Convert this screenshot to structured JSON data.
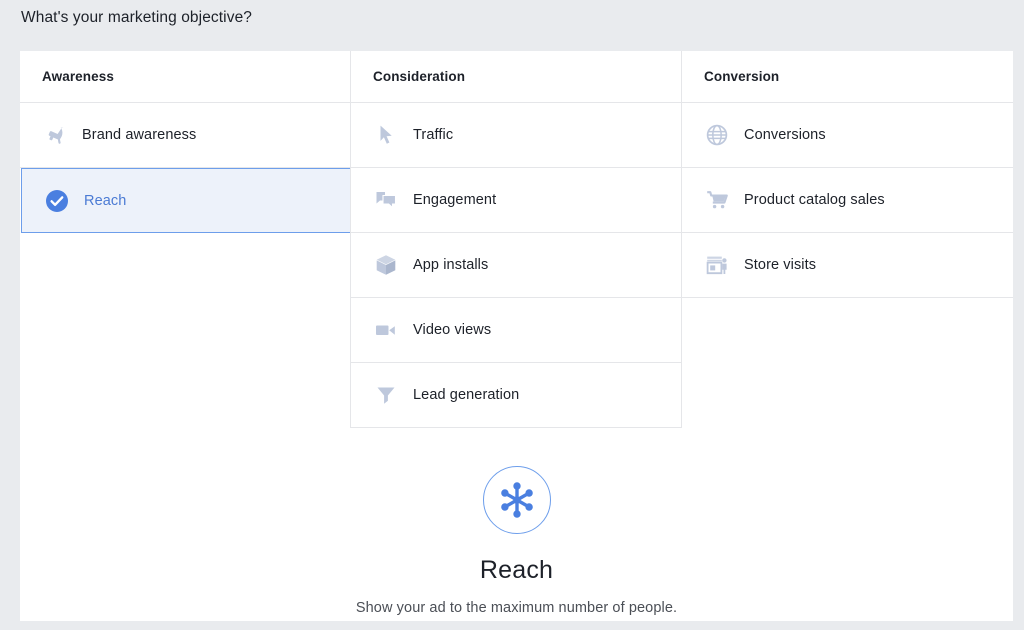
{
  "page": {
    "title": "What's your marketing objective?",
    "background_color": "#e9ebee",
    "card_color": "#ffffff",
    "accent_color": "#4b7bd4",
    "selected_row_bg": "#edf2fa",
    "selected_row_border": "#6d9eeb",
    "icon_color": "#bec8dc",
    "divider_color": "#e5e6e9"
  },
  "columns": [
    {
      "header": "Awareness",
      "items": [
        {
          "label": "Brand awareness",
          "icon": "megaphone-icon",
          "selected": false
        },
        {
          "label": "Reach",
          "icon": "check-circle-icon",
          "selected": true
        }
      ]
    },
    {
      "header": "Consideration",
      "items": [
        {
          "label": "Traffic",
          "icon": "cursor-arrow-icon",
          "selected": false
        },
        {
          "label": "Engagement",
          "icon": "speech-bubbles-icon",
          "selected": false
        },
        {
          "label": "App installs",
          "icon": "cube-box-icon",
          "selected": false
        },
        {
          "label": "Video views",
          "icon": "video-camera-icon",
          "selected": false
        },
        {
          "label": "Lead generation",
          "icon": "funnel-icon",
          "selected": false
        }
      ]
    },
    {
      "header": "Conversion",
      "items": [
        {
          "label": "Conversions",
          "icon": "globe-icon",
          "selected": false
        },
        {
          "label": "Product catalog sales",
          "icon": "shopping-cart-icon",
          "selected": false
        },
        {
          "label": "Store visits",
          "icon": "storefront-person-icon",
          "selected": false
        }
      ]
    }
  ],
  "detail": {
    "icon": "reach-hub-spokes-icon",
    "title": "Reach",
    "description": "Show your ad to the maximum number of people."
  }
}
